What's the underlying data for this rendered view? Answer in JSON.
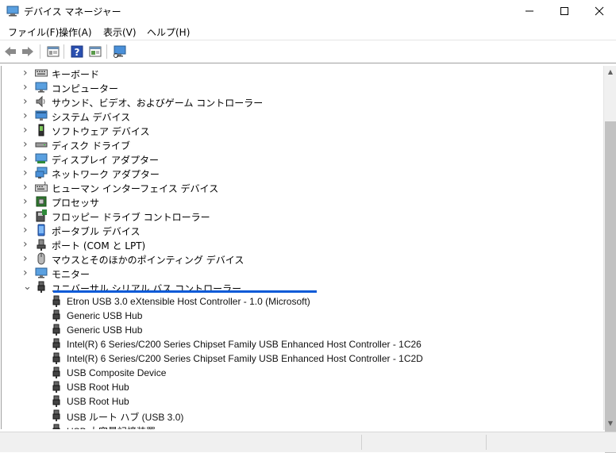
{
  "window": {
    "title": "デバイス マネージャー",
    "controls": {
      "minimize": "—",
      "maximize": "☐",
      "close": "✕"
    }
  },
  "menu": [
    {
      "label": "ファイル(F)"
    },
    {
      "label": "操作(A)"
    },
    {
      "label": "表示(V)"
    },
    {
      "label": "ヘルプ(H)"
    }
  ],
  "toolbar": [
    "back-icon",
    "forward-icon",
    "properties-view-icon",
    "help-icon",
    "properties-icon",
    "monitor-scan-icon"
  ],
  "tree": {
    "categories": [
      {
        "label": "キーボード",
        "icon": "keyboard-icon",
        "expanded": false
      },
      {
        "label": "コンピューター",
        "icon": "computer-icon",
        "expanded": false
      },
      {
        "label": "サウンド、ビデオ、およびゲーム コントローラー",
        "icon": "speaker-icon",
        "expanded": false
      },
      {
        "label": "システム デバイス",
        "icon": "system-device-icon",
        "expanded": false
      },
      {
        "label": "ソフトウェア デバイス",
        "icon": "software-device-icon",
        "expanded": false
      },
      {
        "label": "ディスク ドライブ",
        "icon": "disk-drive-icon",
        "expanded": false
      },
      {
        "label": "ディスプレイ アダプター",
        "icon": "display-adapter-icon",
        "expanded": false
      },
      {
        "label": "ネットワーク アダプター",
        "icon": "network-adapter-icon",
        "expanded": false
      },
      {
        "label": "ヒューマン インターフェイス デバイス",
        "icon": "hid-icon",
        "expanded": false
      },
      {
        "label": "プロセッサ",
        "icon": "processor-icon",
        "expanded": false
      },
      {
        "label": "フロッピー ドライブ コントローラー",
        "icon": "floppy-controller-icon",
        "expanded": false
      },
      {
        "label": "ポータブル デバイス",
        "icon": "portable-device-icon",
        "expanded": false
      },
      {
        "label": "ポート (COM と LPT)",
        "icon": "port-icon",
        "expanded": false
      },
      {
        "label": "マウスとそのほかのポインティング デバイス",
        "icon": "mouse-icon",
        "expanded": false
      },
      {
        "label": "モニター",
        "icon": "monitor-icon",
        "expanded": false
      },
      {
        "label": "ユニバーサル シリアル バス コントローラー",
        "icon": "usb-icon",
        "expanded": true
      }
    ],
    "usb_children": [
      "Etron USB 3.0 eXtensible Host Controller - 1.0 (Microsoft)",
      "Generic USB Hub",
      "Generic USB Hub",
      "Intel(R) 6 Series/C200 Series Chipset Family USB Enhanced Host Controller - 1C26",
      "Intel(R) 6 Series/C200 Series Chipset Family USB Enhanced Host Controller - 1C2D",
      "USB Composite Device",
      "USB Root Hub",
      "USB Root Hub",
      "USB ルート ハブ (USB 3.0)",
      "USB 大容量記憶装置"
    ]
  },
  "colors": {
    "selection_underline": "#0a5ad7",
    "scroll_thumb": "#c2c2c2"
  }
}
